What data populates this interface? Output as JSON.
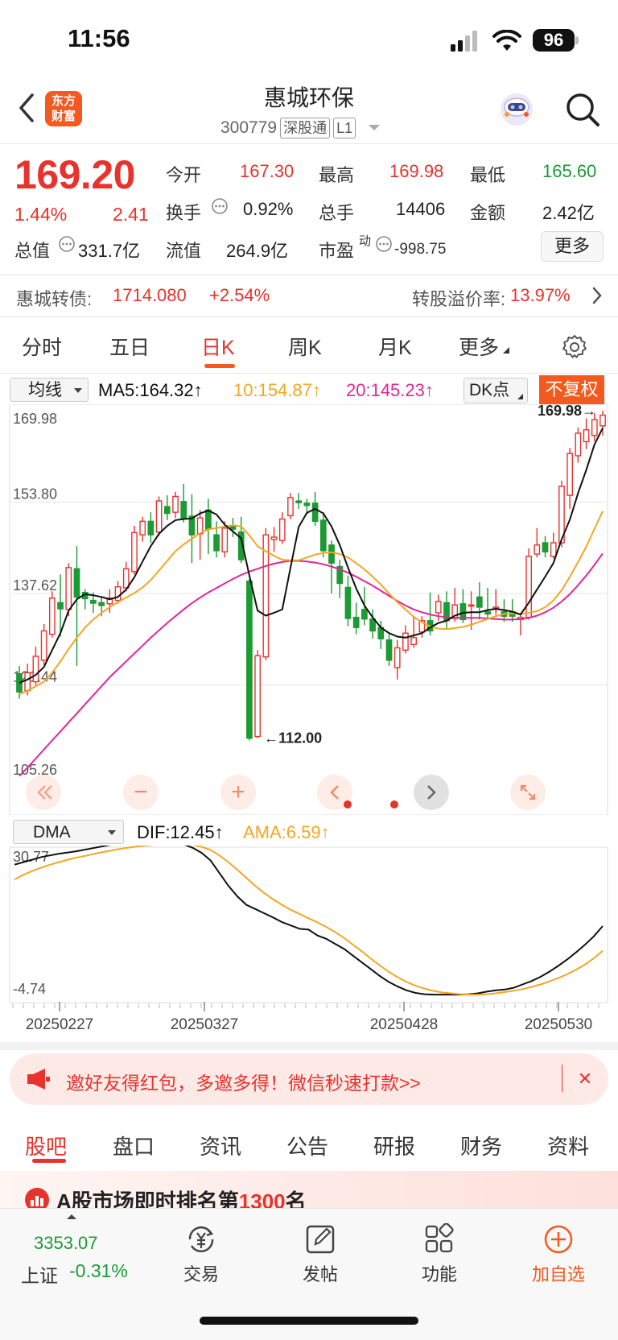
{
  "status_bar": {
    "time": "11:56",
    "battery": "96"
  },
  "header": {
    "logo_line1": "东方",
    "logo_line2": "财富",
    "title": "惠城环保",
    "code": "300779",
    "tag1": "深股通",
    "tag2": "L1"
  },
  "quote": {
    "price": "169.20",
    "change_pct": "1.44%",
    "change": "2.41",
    "open_label": "今开",
    "open": "167.30",
    "high_label": "最高",
    "high": "169.98",
    "low_label": "最低",
    "low": "165.60",
    "turnover_label": "换手",
    "turnover": "0.92%",
    "volume_label": "总手",
    "volume": "14406",
    "amount_label": "金额",
    "amount": "2.42亿",
    "mcap_label": "总值",
    "mcap": "331.7亿",
    "float_label": "流值",
    "float": "264.9亿",
    "pe_label": "市盈",
    "pe_sup": "动",
    "pe": "-998.75",
    "more": "更多"
  },
  "convertible": {
    "label": "惠城转债:",
    "price": "1714.080",
    "change": "+2.54%",
    "premium_label": "转股溢价率:",
    "premium": "13.97%"
  },
  "tabs": [
    "分时",
    "五日",
    "日K",
    "周K",
    "月K",
    "更多"
  ],
  "ma_bar": {
    "select": "均线",
    "ma5": "MA5:164.32↑",
    "ma10": "10:154.87↑",
    "ma20": "20:145.23↑",
    "dk": "DK点",
    "adjust": "不复权"
  },
  "indicator_bar": {
    "select": "DMA",
    "dif": "DIF:12.45↑",
    "ama": "AMA:6.59↑"
  },
  "colors": {
    "up": "#e8322d",
    "down": "#1c9a34",
    "ma5": "#111111",
    "ma10": "#f5a623",
    "ma20": "#e0269b",
    "accent": "#f35a1f"
  },
  "chart_data": [
    {
      "type": "candlestick",
      "y_ticks": [
        "169.98",
        "153.80",
        "137.62",
        "121.44",
        "105.26"
      ],
      "ylim": [
        105.26,
        169.98
      ],
      "annotations": [
        {
          "label": "169.98",
          "value": 169.98,
          "kind": "max"
        },
        {
          "label": "112.00",
          "value": 112.0,
          "kind": "min"
        }
      ],
      "candles": [
        [
          123.4,
          120.2,
          124.8,
          119.0
        ],
        [
          120.4,
          123.6,
          125.2,
          119.6
        ],
        [
          122.0,
          126.5,
          128.2,
          121.4
        ],
        [
          125.8,
          131.0,
          132.2,
          125.0
        ],
        [
          130.4,
          136.8,
          138.0,
          129.8
        ],
        [
          136.0,
          134.9,
          141.0,
          130.0
        ],
        [
          134.8,
          142.2,
          143.0,
          133.6
        ],
        [
          142.0,
          137.0,
          146.0,
          124.8
        ],
        [
          137.8,
          136.7,
          138.4,
          134.8
        ],
        [
          136.4,
          135.9,
          137.8,
          134.2
        ],
        [
          136.0,
          135.5,
          137.0,
          133.6
        ],
        [
          135.8,
          136.8,
          138.4,
          134.2
        ],
        [
          136.4,
          138.8,
          139.8,
          135.8
        ],
        [
          138.6,
          142.0,
          143.2,
          138.0
        ],
        [
          141.5,
          148.4,
          149.6,
          141.0
        ],
        [
          148.0,
          150.4,
          151.2,
          146.8
        ],
        [
          150.4,
          148.0,
          152.0,
          146.6
        ],
        [
          148.5,
          154.0,
          154.8,
          147.8
        ],
        [
          153.0,
          151.8,
          155.0,
          150.6
        ],
        [
          152.0,
          154.8,
          155.6,
          151.0
        ],
        [
          153.9,
          151.0,
          157.0,
          150.2
        ],
        [
          151.3,
          148.0,
          155.2,
          143.0
        ],
        [
          148.2,
          151.0,
          152.4,
          143.6
        ],
        [
          152.4,
          149.0,
          154.4,
          144.6
        ],
        [
          148.0,
          145.2,
          150.4,
          144.0
        ],
        [
          145.0,
          149.2,
          150.4,
          144.0
        ],
        [
          149.6,
          149.0,
          151.0,
          147.6
        ],
        [
          148.5,
          143.6,
          151.2,
          143.0
        ],
        [
          139.8,
          112.0,
          140.2,
          111.6
        ],
        [
          112.3,
          126.6,
          127.6,
          112.0
        ],
        [
          126.4,
          148.0,
          149.2,
          125.8
        ],
        [
          147.2,
          147.6,
          149.4,
          145.0
        ],
        [
          147.0,
          150.8,
          152.0,
          146.4
        ],
        [
          151.4,
          154.6,
          155.4,
          150.8
        ],
        [
          154.0,
          153.7,
          155.4,
          152.6
        ],
        [
          153.6,
          153.2,
          154.4,
          151.6
        ],
        [
          153.6,
          150.4,
          155.6,
          149.6
        ],
        [
          150.6,
          145.2,
          152.0,
          144.0
        ],
        [
          146.2,
          143.0,
          147.0,
          137.6
        ],
        [
          142.4,
          139.4,
          143.6,
          136.8
        ],
        [
          138.7,
          133.2,
          140.8,
          131.8
        ],
        [
          133.4,
          131.6,
          136.0,
          130.4
        ],
        [
          134.8,
          133.1,
          138.8,
          132.0
        ],
        [
          133.1,
          131.0,
          134.8,
          129.6
        ],
        [
          131.6,
          129.6,
          132.8,
          127.8
        ],
        [
          129.4,
          125.8,
          130.4,
          124.8
        ],
        [
          124.5,
          128.0,
          129.4,
          122.4
        ],
        [
          127.6,
          130.6,
          132.0,
          127.0
        ],
        [
          128.6,
          129.8,
          133.6,
          128.0
        ],
        [
          130.8,
          132.8,
          133.6,
          129.8
        ],
        [
          132.8,
          131.0,
          137.8,
          130.2
        ],
        [
          134.2,
          136.2,
          137.4,
          132.8
        ],
        [
          136.0,
          132.8,
          138.0,
          131.4
        ],
        [
          133.2,
          135.6,
          138.6,
          132.6
        ],
        [
          135.8,
          133.0,
          138.4,
          132.4
        ],
        [
          135.4,
          135.6,
          138.0,
          131.2
        ],
        [
          137.0,
          135.2,
          139.6,
          133.0
        ],
        [
          134.4,
          134.0,
          138.6,
          133.0
        ],
        [
          135.0,
          135.2,
          138.4,
          133.8
        ],
        [
          134.4,
          133.6,
          136.6,
          132.6
        ],
        [
          134.4,
          133.6,
          136.6,
          132.6
        ],
        [
          133.0,
          133.4,
          134.2,
          130.2
        ],
        [
          133.4,
          144.2,
          145.6,
          133.0
        ],
        [
          144.6,
          146.2,
          149.2,
          144.0
        ],
        [
          146.6,
          145.0,
          147.8,
          144.0
        ],
        [
          144.2,
          146.6,
          148.4,
          143.8
        ],
        [
          146.6,
          156.6,
          157.6,
          145.8
        ],
        [
          155.0,
          162.4,
          163.4,
          152.6
        ],
        [
          162.0,
          166.0,
          167.0,
          160.8
        ],
        [
          164.5,
          166.6,
          168.6,
          163.2
        ],
        [
          165.6,
          168.4,
          169.6,
          164.6
        ],
        [
          167.3,
          169.2,
          169.98,
          165.6
        ]
      ],
      "ma5": [
        121.8,
        122.4,
        123.2,
        124.6,
        127.6,
        130.6,
        134.6,
        136.6,
        137.5,
        137.3,
        137.0,
        136.6,
        137.0,
        138.3,
        140.5,
        143.3,
        146.0,
        148.2,
        149.6,
        150.6,
        150.8,
        150.9,
        151.8,
        152.3,
        151.6,
        149.8,
        148.6,
        147.4,
        140.8,
        134.6,
        133.7,
        134.2,
        134.8,
        142.2,
        149.4,
        151.9,
        152.6,
        151.8,
        149.5,
        146.2,
        142.2,
        138.5,
        135.5,
        133.4,
        131.6,
        130.6,
        130.0,
        129.8,
        130.2,
        130.6,
        131.6,
        132.4,
        132.8,
        133.7,
        134.2,
        134.3,
        134.3,
        134.7,
        134.9,
        134.7,
        134.4,
        133.9,
        136.0,
        138.3,
        140.6,
        143.0,
        147.2,
        150.7,
        155.4,
        159.5,
        164.0,
        166.9
      ],
      "ma10": [
        119.8,
        120.4,
        121.2,
        122.0,
        123.6,
        125.6,
        127.8,
        129.8,
        131.6,
        133.0,
        134.2,
        135.2,
        136.1,
        136.9,
        137.7,
        138.7,
        140.0,
        141.7,
        143.4,
        145.1,
        146.3,
        147.3,
        148.3,
        149.0,
        149.2,
        149.5,
        149.7,
        149.5,
        147.9,
        146.0,
        145.1,
        144.3,
        143.6,
        143.5,
        143.5,
        144.0,
        144.5,
        144.8,
        144.9,
        144.6,
        144.0,
        143.0,
        141.9,
        140.6,
        139.2,
        137.6,
        136.1,
        134.8,
        133.5,
        132.5,
        131.8,
        131.4,
        131.3,
        131.5,
        131.7,
        132.1,
        132.6,
        133.1,
        133.6,
        134.0,
        134.1,
        134.0,
        134.2,
        134.5,
        135.2,
        136.4,
        138.2,
        140.6,
        143.2,
        145.9,
        149.1,
        152.2
      ],
      "ma20": [
        105.3,
        106.8,
        108.4,
        110.0,
        111.6,
        113.2,
        114.8,
        116.4,
        118.0,
        119.6,
        121.2,
        122.8,
        124.2,
        125.6,
        127.0,
        128.4,
        129.8,
        131.1,
        132.4,
        133.6,
        134.8,
        135.9,
        136.9,
        137.8,
        138.6,
        139.4,
        140.2,
        140.9,
        141.5,
        142.0,
        142.5,
        142.9,
        143.2,
        143.4,
        143.4,
        143.3,
        143.1,
        142.8,
        142.4,
        141.9,
        141.3,
        140.6,
        139.8,
        139.0,
        138.1,
        137.2,
        136.3,
        135.5,
        134.8,
        134.3,
        133.9,
        133.6,
        133.4,
        133.3,
        133.3,
        133.3,
        133.3,
        133.2,
        133.1,
        133.0,
        133.0,
        133.1,
        133.3,
        133.7,
        134.3,
        135.1,
        136.2,
        137.5,
        139.1,
        140.8,
        142.7,
        144.7
      ]
    },
    {
      "type": "line",
      "y_ticks": [
        "30.77",
        "-4.74"
      ],
      "ylim": [
        -4.74,
        30.77
      ],
      "x_ticks": [
        "20250227",
        "20250327",
        "20250428",
        "20250530"
      ],
      "series": [
        {
          "name": "DIF",
          "values": [
            27.0,
            27.6,
            28.2,
            28.8,
            29.2,
            29.6,
            29.9,
            30.2,
            30.6,
            31.0,
            31.4,
            31.8,
            32.1,
            32.4,
            32.6,
            32.7,
            32.7,
            32.6,
            32.3,
            31.8,
            31.0,
            29.8,
            28.0,
            25.0,
            22.0,
            19.5,
            17.5,
            16.5,
            15.5,
            14.5,
            13.4,
            12.6,
            11.8,
            11.6,
            10.2,
            9.4,
            8.2,
            7.0,
            5.4,
            3.8,
            2.2,
            0.6,
            -0.8,
            -1.9,
            -2.8,
            -3.4,
            -3.7,
            -3.8,
            -3.8,
            -3.8,
            -3.8,
            -3.7,
            -3.5,
            -3.1,
            -2.8,
            -2.6,
            -2.2,
            -1.4,
            -0.6,
            0.4,
            1.6,
            3.0,
            4.5,
            6.2,
            8.0,
            10.0,
            12.45
          ]
        },
        {
          "name": "AMA",
          "values": [
            23.5,
            24.6,
            25.5,
            26.3,
            27.0,
            27.6,
            28.2,
            28.7,
            29.1,
            29.6,
            30.0,
            30.4,
            30.8,
            31.1,
            31.4,
            31.6,
            31.8,
            31.9,
            32.0,
            31.9,
            31.7,
            31.2,
            30.5,
            29.2,
            27.6,
            25.8,
            23.9,
            22.0,
            20.3,
            18.8,
            17.5,
            16.3,
            15.3,
            14.3,
            13.3,
            12.2,
            11.0,
            9.6,
            8.0,
            6.4,
            4.7,
            3.1,
            1.6,
            0.3,
            -0.8,
            -1.7,
            -2.4,
            -2.9,
            -3.3,
            -3.5,
            -3.7,
            -3.8,
            -3.8,
            -3.7,
            -3.5,
            -3.2,
            -2.9,
            -2.5,
            -2.0,
            -1.4,
            -0.7,
            0.1,
            1.0,
            2.1,
            3.3,
            4.8,
            6.59
          ]
        }
      ]
    }
  ],
  "chart_tools": {
    "zoom_out": "−",
    "zoom_in": "+"
  },
  "banner": {
    "text": "邀好友得红包，多邀多得！微信秒速打款>>",
    "close": "✕"
  },
  "bottom_tabs": [
    "股吧",
    "盘口",
    "资讯",
    "公告",
    "研报",
    "财务",
    "资料"
  ],
  "peek_card": {
    "text_prefix": "A股市场即时排名第",
    "rank": "1300",
    "text_suffix": "名"
  },
  "index": {
    "value": "3353.07",
    "name": "上证",
    "change": "-0.31%"
  },
  "nav": [
    "交易",
    "发帖",
    "功能",
    "加自选"
  ]
}
